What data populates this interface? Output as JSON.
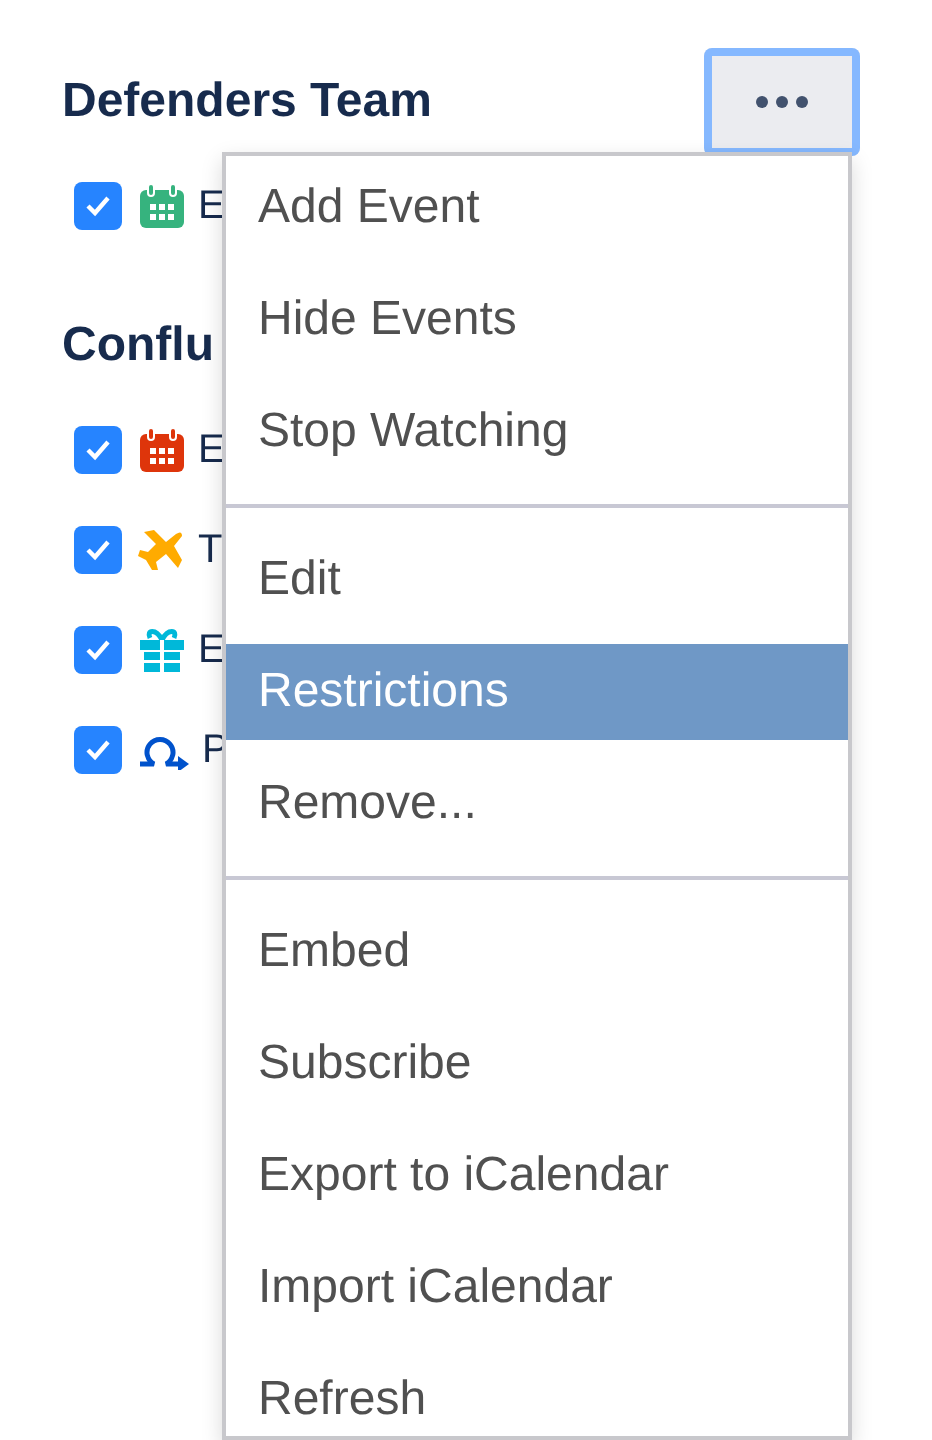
{
  "groups": [
    {
      "title": "Defenders Team",
      "calendars": [
        {
          "label": "E",
          "checked": true,
          "kind": "calendar",
          "color": "#36b37e"
        }
      ]
    },
    {
      "title": "Conflu",
      "calendars": [
        {
          "label": "E",
          "checked": true,
          "kind": "calendar",
          "color": "#de350b"
        },
        {
          "label": "T",
          "checked": true,
          "kind": "plane",
          "color": "#ffab00"
        },
        {
          "label": "E",
          "checked": true,
          "kind": "gift",
          "color": "#00b8d9"
        },
        {
          "label": "P",
          "checked": true,
          "kind": "loop",
          "color": "#0052cc"
        }
      ]
    }
  ],
  "more_button": {
    "focused": true
  },
  "menu": {
    "sections": [
      [
        {
          "label": "Add Event",
          "selected": false
        },
        {
          "label": "Hide Events",
          "selected": false
        },
        {
          "label": "Stop Watching",
          "selected": false
        }
      ],
      [
        {
          "label": "Edit",
          "selected": false
        },
        {
          "label": "Restrictions",
          "selected": true
        },
        {
          "label": "Remove...",
          "selected": false
        }
      ],
      [
        {
          "label": "Embed",
          "selected": false
        },
        {
          "label": "Subscribe",
          "selected": false
        },
        {
          "label": "Export to iCalendar",
          "selected": false
        },
        {
          "label": "Import iCalendar",
          "selected": false
        },
        {
          "label": "Refresh",
          "selected": false
        }
      ]
    ]
  }
}
